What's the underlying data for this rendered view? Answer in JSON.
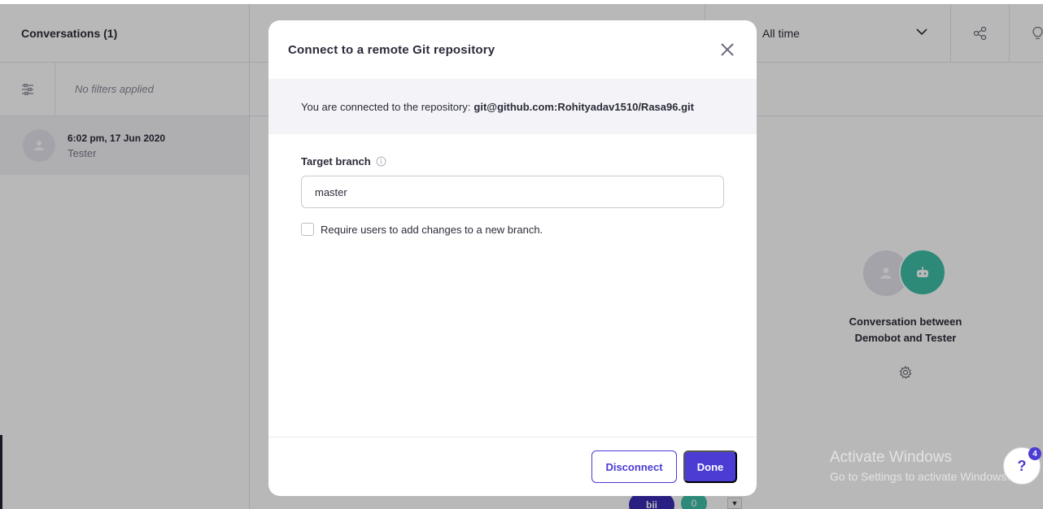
{
  "background": {
    "conversations_title": "Conversations (1)",
    "filters_text": "No filters applied",
    "conversation": {
      "time": "6:02 pm, 17 Jun 2020",
      "name": "Tester"
    },
    "time_filter": "All time",
    "bot_caption_line1": "Conversation between",
    "bot_caption_line2": "Demobot and Tester",
    "chip_bii": "bii",
    "chip_zero": "0",
    "caret": "▼"
  },
  "modal": {
    "title": "Connect to a remote Git repository",
    "repo_prefix": "You are connected to the repository:",
    "repo_url": "git@github.com:Rohityadav1510/Rasa96.git",
    "target_branch_label": "Target branch",
    "target_branch_value": "master",
    "require_branch_label": "Require users to add changes to a new branch.",
    "disconnect_label": "Disconnect",
    "done_label": "Done"
  },
  "windows_watermark": {
    "line1": "Activate Windows",
    "line2": "Go to Settings to activate Windows."
  },
  "help": {
    "label": "?",
    "badge": "4"
  },
  "colors": {
    "accent": "#4b3cd4",
    "bot": "#3fbfa7",
    "text": "#2b2b3a"
  }
}
